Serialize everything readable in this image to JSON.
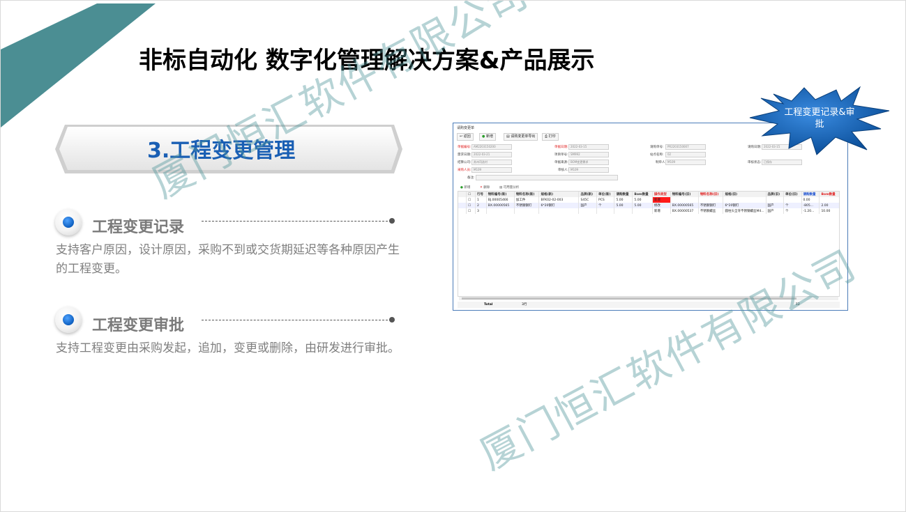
{
  "main_title": "非标自动化 数字化管理解决方案&产品展示",
  "section_title": "3.工程变更管理",
  "items": [
    {
      "title": "工程变更记录",
      "desc": "支持客户原因，设计原因，采购不到或交货期延迟等各种原因产生的工程变更。"
    },
    {
      "title": "工程变更审批",
      "desc": "支持工程变更由采购发起，追加，变更或删除，由研发进行审批。"
    }
  ],
  "watermark": "厦门恒汇软件有限公司",
  "badge": "工程变更记录&审批",
  "colors": {
    "accent_teal": "#4b8e93",
    "section_blue": "#1a5fb4",
    "badge_blue": "#1565c0"
  },
  "screenshot": {
    "window_title": "请购变更单",
    "toolbar": [
      "返回",
      "新增",
      "请购变更单导出",
      "打印"
    ],
    "fields": {
      "doc_no_label": "单据编号:",
      "doc_no": "AM2203150200",
      "doc_date_label": "单据日期:",
      "doc_date": "2022-03-15",
      "req_no_label": "请购单号:",
      "req_no": "PR2203150007",
      "req_date_label": "请购日期:",
      "req_date": "2022-03-15",
      "need_date_label": "需求日期:",
      "need_date": "2022-03-21",
      "project_label": "项目单号:",
      "project": "SM992",
      "site_label": "站点名称:",
      "site": "02",
      "company_label": "结算公司:",
      "company": "苏州司选村",
      "source_label": "单据来源:",
      "source": "BOM变更需求",
      "maker_label": "制单人:",
      "maker": "M109",
      "audit_status_label": "审核状态:",
      "audit_status": "已保存",
      "buyer_label": "采购人员:",
      "buyer": "M109",
      "auditor_label": "审核人:",
      "auditor": "M109",
      "remark_label": "备注:"
    },
    "grid_toolbar": [
      "新增",
      "删除",
      "可用量分析"
    ],
    "columns": [
      "行号",
      "物料编号(新)",
      "物料名称(新)",
      "规格(新)",
      "品牌(新)",
      "单位(新)",
      "请购数量",
      "Bom数量",
      "操作类型",
      "物料编号(旧)",
      "物料名称(旧)",
      "规格(旧)",
      "品牌(旧)",
      "单位(旧)",
      "请购数量",
      "Bom数量"
    ],
    "rows": [
      [
        "1",
        "BJ.00005466",
        "加工件",
        "BFK02-02-003",
        "S45C",
        "PCS",
        "5.00",
        "5.00",
        "新增",
        "",
        "",
        "",
        "",
        "",
        "",
        "0.00"
      ],
      [
        "2",
        "BX.00000565",
        "不锈钢钢钉",
        "6*20钢钉",
        "国产",
        "个",
        "5.00",
        "5.00",
        "修改",
        "BX.00000565",
        "不锈钢钢钉",
        "6*20钢钉",
        "国产",
        "个",
        "-805...",
        "2.00",
        "2.00"
      ],
      [
        "3",
        "",
        "",
        "",
        "",
        "",
        "",
        "",
        "新增",
        "BX.00000537",
        "不锈钢螺丝",
        "圆柱头全牙不锈钢螺丝M4...",
        "国产",
        "个",
        "-1.20...",
        "10.00",
        "10.00"
      ]
    ],
    "footer_label": "Total",
    "footer_count": "3行",
    "footer_value": "12"
  }
}
